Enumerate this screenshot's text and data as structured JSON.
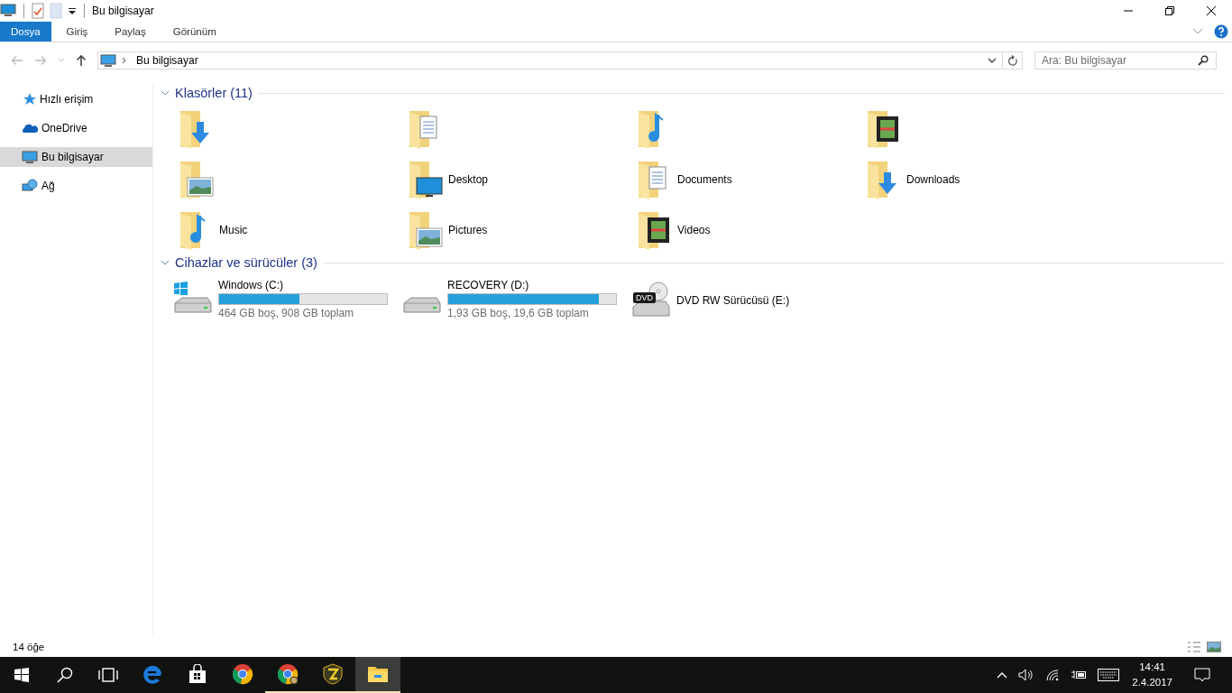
{
  "window": {
    "title": "Bu bilgisayar"
  },
  "ribbon_tabs": [
    {
      "label": "Dosya",
      "selected": true
    },
    {
      "label": "Giriş",
      "selected": false
    },
    {
      "label": "Paylaş",
      "selected": false
    },
    {
      "label": "Görünüm",
      "selected": false
    }
  ],
  "address": {
    "path": "Bu bilgisayar"
  },
  "search": {
    "placeholder": "Ara: Bu bilgisayar"
  },
  "sidebar": {
    "items": [
      {
        "label": "Hızlı erişim",
        "kind": "star",
        "selected": false
      },
      {
        "label": "OneDrive",
        "kind": "cloud",
        "selected": false
      },
      {
        "label": "Bu bilgisayar",
        "kind": "pc",
        "selected": true
      },
      {
        "label": "Ağ",
        "kind": "network",
        "selected": false
      }
    ]
  },
  "folders": {
    "heading": "Klasörler (11)",
    "items": [
      {
        "kind": "downloads"
      },
      {
        "kind": "documents"
      },
      {
        "kind": "music"
      },
      {
        "kind": "videos"
      },
      {
        "kind": "pictures"
      },
      {
        "label": "Desktop",
        "kind": "desktop"
      },
      {
        "label": "Documents",
        "kind": "documents"
      },
      {
        "label": "Downloads",
        "kind": "downloads"
      },
      {
        "label": "Music",
        "kind": "music"
      },
      {
        "label": "Pictures",
        "kind": "pictures"
      },
      {
        "label": "Videos",
        "kind": "videos"
      }
    ]
  },
  "drives": {
    "heading": "Cihazlar ve sürücüler (3)",
    "items": [
      {
        "label": "Windows (C:)",
        "kind": "system",
        "level": 0.48,
        "info": "464 GB boş, 908 GB toplam"
      },
      {
        "label": "RECOVERY (D:)",
        "kind": "disk",
        "level": 0.9,
        "info": "1,93 GB boş, 19,6 GB toplam"
      },
      {
        "label": "DVD RW Sürücüsü (E:)",
        "kind": "dvd",
        "badge": "DVD"
      }
    ]
  },
  "status_bar": {
    "count": "14 öğe"
  },
  "taskbar": {
    "apps": [
      {
        "kind": "edge",
        "running": false,
        "selected": false
      },
      {
        "kind": "store",
        "running": false,
        "selected": false
      },
      {
        "kind": "chrome",
        "running": false,
        "selected": false
      },
      {
        "kind": "chrome-user",
        "running": true,
        "selected": false
      },
      {
        "kind": "z",
        "running": true,
        "selected": false
      },
      {
        "kind": "explorer",
        "running": true,
        "selected": true
      }
    ],
    "time": "14:41",
    "date": "2.4.2017"
  }
}
